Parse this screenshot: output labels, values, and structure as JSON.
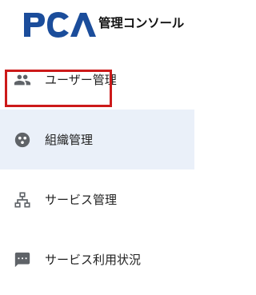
{
  "header": {
    "logo_text": "PCA",
    "title": "管理コンソール",
    "brand_color": "#1b4d9b"
  },
  "nav": {
    "items": [
      {
        "label": "ユーザー管理",
        "icon": "people-icon",
        "active": false
      },
      {
        "label": "組織管理",
        "icon": "organization-icon",
        "active": true
      },
      {
        "label": "サービス管理",
        "icon": "hierarchy-icon",
        "active": false
      },
      {
        "label": "サービス利用状況",
        "icon": "comment-icon",
        "active": false
      }
    ]
  },
  "colors": {
    "active_bg": "#eaf0f9",
    "highlight_border": "#cc1a1a",
    "icon": "#5f6368"
  }
}
